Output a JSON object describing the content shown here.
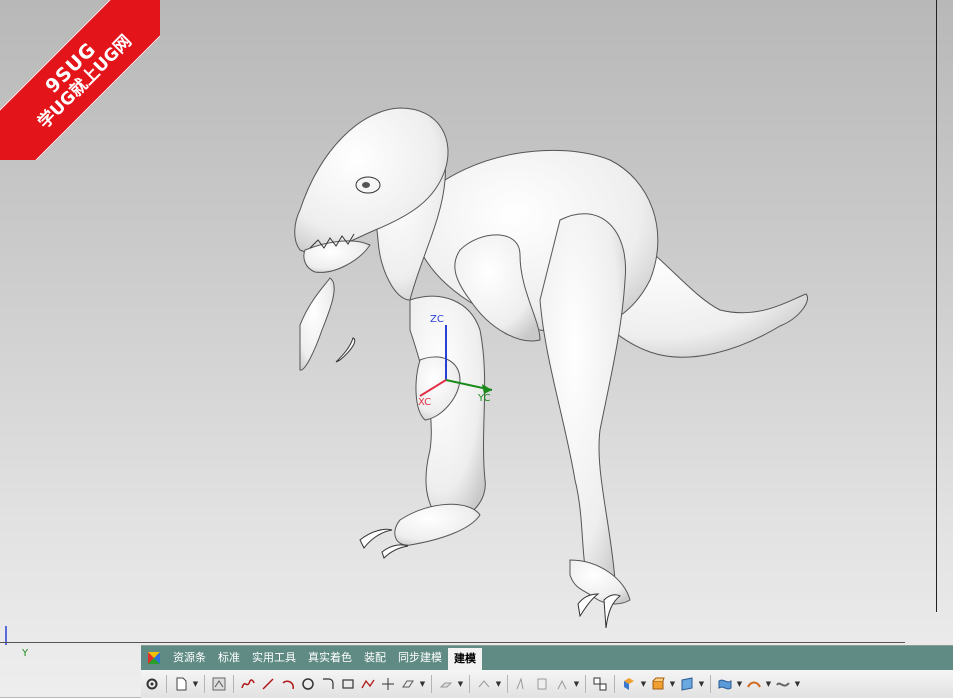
{
  "watermark": {
    "brand": "9SUG",
    "slogan": "学UG就上UG网"
  },
  "viewport": {
    "axis_labels": {
      "z": "ZC",
      "x": "XC",
      "y": "YC"
    },
    "csys_label": "Y"
  },
  "toolbar": {
    "tabs": [
      {
        "label": "资源条"
      },
      {
        "label": "标准"
      },
      {
        "label": "实用工具"
      },
      {
        "label": "真实着色"
      },
      {
        "label": "装配"
      },
      {
        "label": "同步建模"
      },
      {
        "label": "建模",
        "active": true
      }
    ],
    "icons": [
      "gear-icon",
      "new-part-icon",
      "sketch-icon",
      "studio-spline-icon",
      "line-icon",
      "arc-icon",
      "circle-icon",
      "fillet-icon",
      "rectangle-icon",
      "polyline-icon",
      "point-icon",
      "datum-plane-icon",
      "extrude-icon",
      "revolve-icon",
      "edge-blend-icon",
      "chamfer-icon",
      "hole-icon",
      "boolean-icon",
      "shell-icon",
      "box-icon",
      "surface-icon",
      "mesh-surface-icon",
      "sweep-icon"
    ]
  }
}
